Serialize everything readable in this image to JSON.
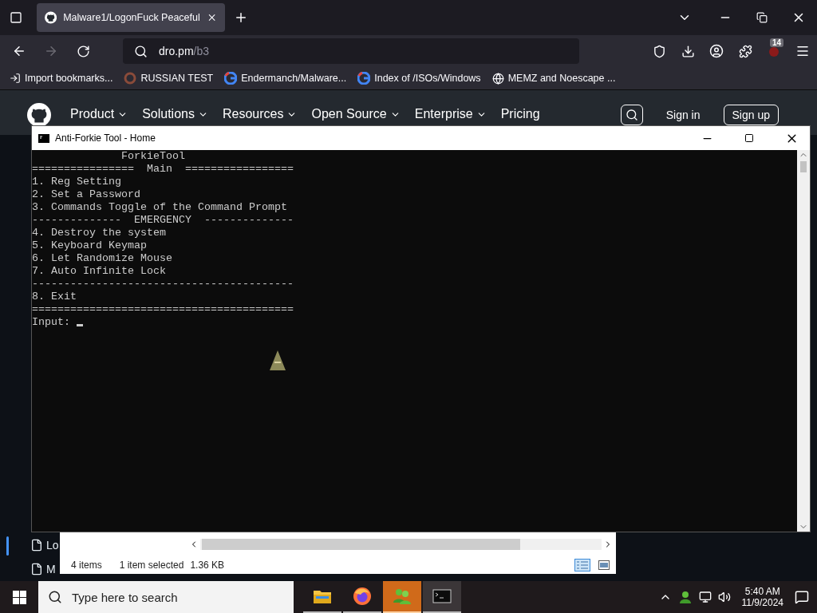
{
  "browser": {
    "tab_title": "Malware1/LogonFuck Peaceful",
    "url_host": "dro.pm",
    "url_path": "/b3",
    "extension_badge": "14",
    "bookmarks": [
      {
        "kind": "import",
        "label": "Import bookmarks..."
      },
      {
        "kind": "ring",
        "label": "RUSSIAN TEST"
      },
      {
        "kind": "google",
        "label": "Endermanch/Malware..."
      },
      {
        "kind": "google",
        "label": "Index of /ISOs/Windows"
      },
      {
        "kind": "globe",
        "label": "MEMZ and Noescape ..."
      }
    ]
  },
  "site_header": {
    "nav": [
      "Product",
      "Solutions",
      "Resources",
      "Open Source",
      "Enterprise"
    ],
    "pricing": "Pricing",
    "sign_in": "Sign in",
    "sign_up": "Sign up"
  },
  "file_list": [
    "Lo",
    "M"
  ],
  "console": {
    "title": "Anti-Forkie Tool - Home",
    "lines": [
      "              ForkieTool",
      "================  Main  =================",
      "1. Reg Setting",
      "2. Set a Password",
      "3. Commands Toggle of the Command Prompt",
      "--------------  EMERGENCY  --------------",
      "4. Destroy the system",
      "5. Keyboard Keymap",
      "6. Let Randomize Mouse",
      "7. Auto Infinite Lock",
      "-----------------------------------------",
      "8. Exit",
      "========================================="
    ],
    "prompt": "Input:"
  },
  "explorer_status": {
    "items": "4 items",
    "selected": "1 item selected",
    "size": "1.36 KB"
  },
  "taskbar": {
    "search_placeholder": "Type here to search",
    "apps": [
      {
        "kind": "folder",
        "selected": false
      },
      {
        "kind": "firefox",
        "selected": false
      },
      {
        "kind": "people",
        "selected": true
      },
      {
        "kind": "terminal",
        "selected": false
      }
    ],
    "time": "5:40 AM",
    "date": "11/9/2024"
  }
}
